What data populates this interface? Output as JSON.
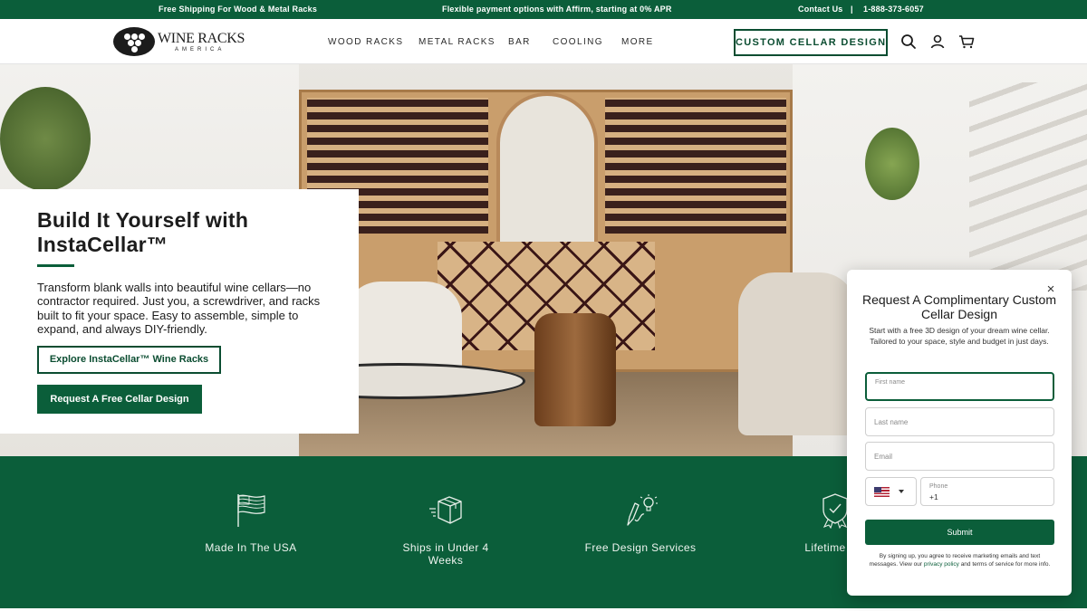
{
  "announcement": {
    "shipping": "Free Shipping For Wood & Metal Racks",
    "financing": "Flexible payment options with Affirm, starting at 0% APR",
    "contact": "Contact Us",
    "separator": "|",
    "phone": "1-888-373-6057"
  },
  "header": {
    "logo_name": "WINE RACKS",
    "logo_sub": "AMERICA",
    "nav": [
      "WOOD RACKS",
      "METAL RACKS",
      "BAR",
      "COOLING",
      "MORE"
    ],
    "cta": "CUSTOM CELLAR DESIGN",
    "icons": [
      "search-icon",
      "account-icon",
      "cart-icon"
    ]
  },
  "hero": {
    "title": "Build It Yourself with InstaCellar™",
    "body": "Transform blank walls into beautiful wine cellars—no contractor required. Just you, a screwdriver, and racks built to fit your space. Easy to assemble, simple to expand, and always DIY-friendly.",
    "button_primary": "Explore InstaCellar™ Wine Racks",
    "button_secondary": "Request A Free Cellar Design"
  },
  "features": [
    {
      "label": "Made In The USA",
      "icon": "flag-icon"
    },
    {
      "label": "Ships in Under 4 Weeks",
      "icon": "shipping-box-icon"
    },
    {
      "label": "Free Design Services",
      "icon": "design-pencil-icon"
    },
    {
      "label": "Lifetime Wa",
      "icon": "warranty-badge-icon"
    }
  ],
  "modal": {
    "close": "×",
    "title": "Request A Complimentary Custom Cellar Design",
    "subtitle": "Start with a free 3D design of your dream wine cellar. Tailored to your space, style and budget in just days.",
    "fields": {
      "first_name": "First name",
      "last_name": "Last name",
      "email": "Email",
      "phone_label": "Phone",
      "phone_value": "+1"
    },
    "submit": "Submit",
    "legal_pre": "By signing up, you agree to receive marketing emails and text messages. View our ",
    "legal_link": "privacy policy",
    "legal_post": " and terms of service for more info."
  },
  "colors": {
    "brand_green": "#0b5e3a",
    "text_dark": "#1c1c1c",
    "white": "#ffffff"
  }
}
